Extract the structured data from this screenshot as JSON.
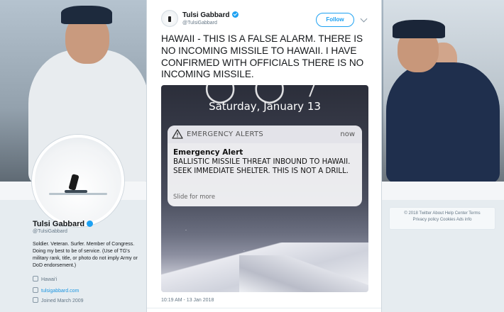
{
  "profile": {
    "name": "Tulsi Gabbard",
    "handle": "@TulsiGabbard",
    "bio": "Soldier. Veteran. Surfer. Member of Congress. Doing my best to be of service. (Use of TG's military rank, title, or photo do not imply Army or DoD endorsement.)",
    "location": "Hawai'i",
    "website": "tulsigabbard.com",
    "joined": "Joined March 2009"
  },
  "footer_links": {
    "line1": "© 2018 Twitter  About  Help Center  Terms",
    "line2": "Privacy policy  Cookies  Ads info"
  },
  "tweet": {
    "author_name": "Tulsi Gabbard",
    "author_handle": "@TulsiGabbard",
    "follow_label": "Follow",
    "text": "HAWAII - THIS IS A FALSE ALARM. THERE IS NO INCOMING MISSILE TO HAWAII. I HAVE CONFIRMED WITH OFFICIALS THERE IS NO INCOMING MISSILE.",
    "timestamp": "10:19 AM - 13 Jan 2018"
  },
  "media": {
    "lock_date": "Saturday, January 13",
    "alert_app": "EMERGENCY ALERTS",
    "alert_time": "now",
    "alert_title": "Emergency Alert",
    "alert_body": "BALLISTIC MISSILE THREAT INBOUND TO HAWAII. SEEK IMMEDIATE SHELTER. THIS IS NOT A DRILL.",
    "alert_action": "Slide for more"
  },
  "icons": {
    "verified": "verified-badge-icon",
    "caret": "chevron-down-icon",
    "warning": "warning-triangle-icon",
    "location": "location-pin-icon",
    "link": "link-icon",
    "calendar": "calendar-icon"
  },
  "colors": {
    "accent": "#1da1f2",
    "text": "#14171a",
    "muted": "#657786"
  }
}
